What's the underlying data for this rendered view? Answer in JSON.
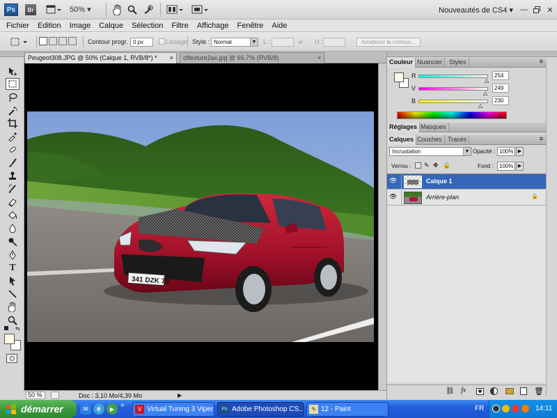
{
  "appbar": {
    "logo": "Ps",
    "bridge": "Br",
    "zoom": "50%",
    "workspace": "Nouveautés de CS4",
    "icons": [
      "view-extras-icon",
      "hand-icon",
      "zoom-icon",
      "rotate-view-icon",
      "arrange-documents-icon",
      "screen-mode-icon"
    ]
  },
  "menu": [
    "Fichier",
    "Edition",
    "Image",
    "Calque",
    "Sélection",
    "Filtre",
    "Affichage",
    "Fenêtre",
    "Aide"
  ],
  "options": {
    "contour_label": "Contour progr. :",
    "contour_value": "0 px",
    "lissage_label": "Lissage",
    "style_label": "Style :",
    "style_value": "Normal",
    "l_label": "L :",
    "h_label": "H :",
    "refine_button": "Améliorer le contour..."
  },
  "tabs": {
    "active": "Peugeot308.JPG @ 50% (Calque 1, RVB/8*) *",
    "inactive": "cftexture2ax.jpg @ 66,7% (RVB/8)",
    "close": "×"
  },
  "status": {
    "zoom": "50 %",
    "doc": "Doc : 3,10 Mo/4,39 Mo"
  },
  "photo": {
    "plate": "341 DZK 78"
  },
  "color_panel": {
    "tabs": [
      "Couleur",
      "Nuancier",
      "Styles"
    ],
    "channels": [
      {
        "label": "R",
        "value": "254",
        "level": 0.996
      },
      {
        "label": "V",
        "value": "249",
        "level": 0.976
      },
      {
        "label": "B",
        "value": "230",
        "level": 0.902
      }
    ],
    "fg_color": "#fef9e6"
  },
  "adjust_panel": {
    "tabs": [
      "Réglages",
      "Masques"
    ]
  },
  "layers_panel": {
    "tabs": [
      "Calques",
      "Couches",
      "Tracés"
    ],
    "blend_mode": "Incrustation",
    "opacity_label": "Opacité :",
    "opacity": "100%",
    "lock_label": "Verrou :",
    "fill_label": "Fond :",
    "fill": "100%",
    "layers": [
      {
        "name": "Calque 1",
        "selected": true
      },
      {
        "name": "Arrière-plan",
        "selected": false
      }
    ],
    "footer_icons": [
      "link-icon",
      "fx-icon",
      "mask-icon",
      "adjustment-icon",
      "folder-icon",
      "new-layer-icon",
      "trash-icon"
    ]
  },
  "taskbar": {
    "start": "démarrer",
    "tasks": [
      {
        "label": "Virtual Tuning 3 Viper",
        "active": false
      },
      {
        "label": "Adobe Photoshop CS...",
        "active": true
      },
      {
        "label": "12 - Paint",
        "active": false
      }
    ],
    "lang": "FR",
    "clock": "14:11"
  }
}
